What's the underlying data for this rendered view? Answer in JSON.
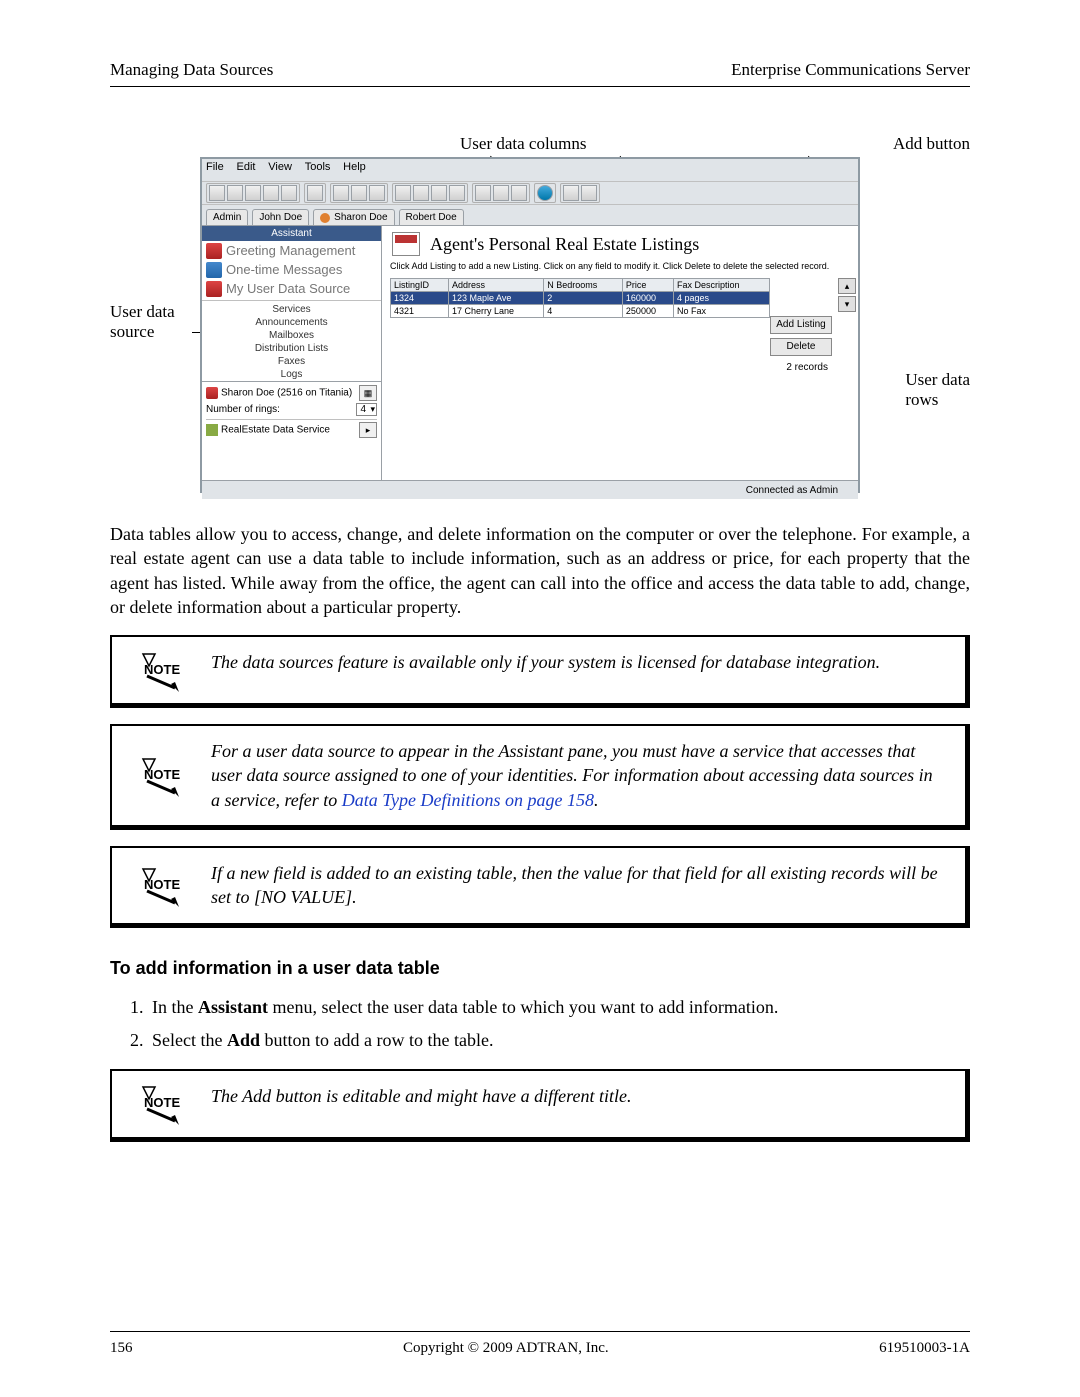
{
  "header": {
    "left": "Managing Data Sources",
    "right": "Enterprise Communications Server"
  },
  "figure": {
    "callouts": {
      "source": "User data\nsource",
      "columns": "User data columns",
      "add": "Add button",
      "rows": "User data\nrows"
    },
    "menubar": [
      "File",
      "Edit",
      "View",
      "Tools",
      "Help"
    ],
    "tabs": [
      "Admin",
      "John Doe",
      "Sharon Doe",
      "Robert Doe"
    ],
    "nav": {
      "head": "Assistant",
      "items": [
        "Greeting Management",
        "One-time Messages",
        "My User Data Source"
      ],
      "sub": [
        "Services",
        "Announcements",
        "Mailboxes",
        "Distribution Lists",
        "Faxes",
        "Logs"
      ],
      "footer": {
        "line1": "Sharon Doe (2516 on Titania)",
        "rings_label": "Number of rings:",
        "rings_value": "4",
        "service": "RealEstate Data Service"
      }
    },
    "details": {
      "title": "Agent's Personal Real Estate Listings",
      "hint": "Click Add Listing to add a new Listing. Click on any field to modify it. Click Delete to delete the selected record.",
      "columns": [
        "ListingID",
        "Address",
        "N Bedrooms",
        "Price",
        "Fax Description"
      ],
      "rows": [
        [
          "1324",
          "123 Maple Ave",
          "2",
          "160000",
          "4 pages"
        ],
        [
          "4321",
          "17 Cherry Lane",
          "4",
          "250000",
          "No Fax"
        ]
      ],
      "buttons": {
        "add": "Add Listing",
        "delete": "Delete"
      },
      "count": "2 records"
    },
    "status": "Connected as Admin"
  },
  "para1": "Data tables allow you to access, change, and delete information on the computer or over the telephone. For example, a real estate agent can use a data table to include information, such as an address or price, for each property that the agent has listed. While away from the office, the agent can call into the office and access the data table to add, change, or delete information about a particular property.",
  "notes": {
    "n1": "The data sources feature is available only if your system is licensed for database integration.",
    "n2a": "For a user data source to appear in the Assistant pane, you must have a service that accesses that user data source assigned to one of your identities. For information about accessing data sources in a service, refer to ",
    "n2link": "Data Type Definitions on page 158",
    "n2b": ".",
    "n3": "If a new field is added to an existing table, then the value for that field for all existing records will be set to [NO VALUE].",
    "n4": "The Add button is editable and might have a different title."
  },
  "section": {
    "heading": "To add information in a user data table",
    "step1a": "In the ",
    "step1b": "Assistant",
    "step1c": " menu, select the user data table to which you want to add information.",
    "step2a": "Select the ",
    "step2b": "Add",
    "step2c": " button to add a row to the table."
  },
  "footer": {
    "page": "156",
    "center": "Copyright © 2009 ADTRAN, Inc.",
    "right": "619510003-1A"
  }
}
